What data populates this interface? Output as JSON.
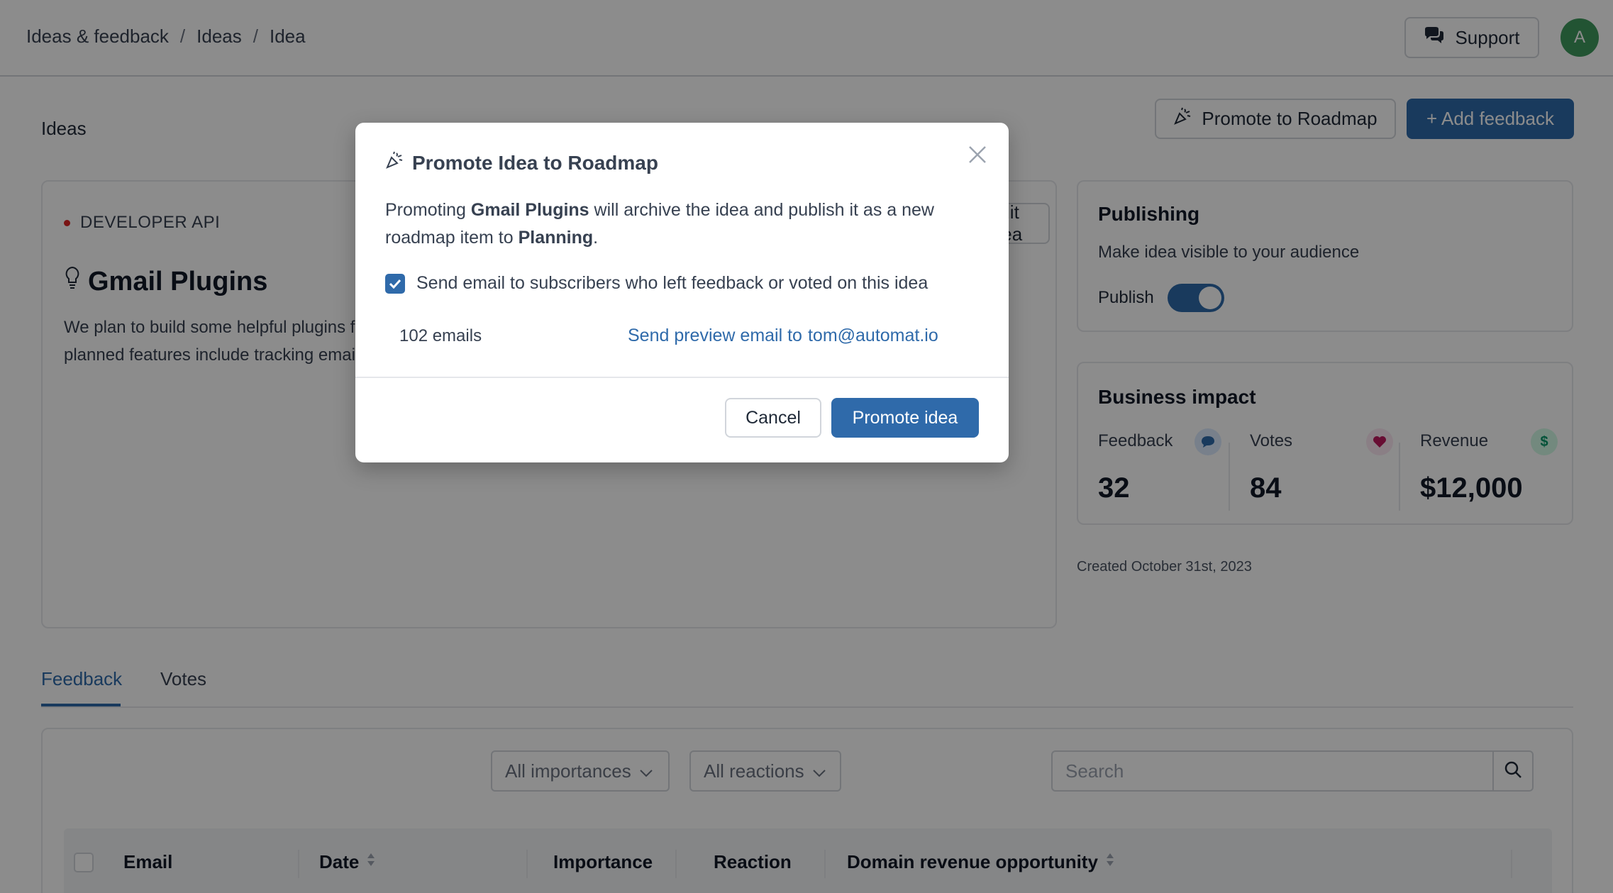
{
  "breadcrumb": {
    "items": [
      "Ideas & feedback",
      "Ideas",
      "Idea"
    ],
    "sep": "/"
  },
  "topbar": {
    "support_label": "Support",
    "avatar_initial": "A"
  },
  "header": {
    "section_title": "Ideas",
    "promote_label": "Promote to Roadmap",
    "add_feedback_label": "+ Add feedback"
  },
  "idea": {
    "category": "DEVELOPER API",
    "title": "Gmail Plugins",
    "description": "We plan to build some helpful plugins for Gmail to make it easier for you to make better use of Acme features. Some of the planned features include tracking email open and click through rate, and auto-organizing your inbox.",
    "edit_label": "Edit idea"
  },
  "publishing": {
    "title": "Publishing",
    "subtitle": "Make idea visible to your audience",
    "publish_label": "Publish",
    "published": true
  },
  "impact": {
    "title": "Business impact",
    "metrics": [
      {
        "label": "Feedback",
        "value": "32"
      },
      {
        "label": "Votes",
        "value": "84"
      },
      {
        "label": "Revenue",
        "value": "$12,000"
      }
    ]
  },
  "created": "Created October 31st, 2023",
  "tabs": [
    {
      "label": "Feedback",
      "active": true
    },
    {
      "label": "Votes",
      "active": false
    }
  ],
  "filters": {
    "importance": "All importances",
    "reactions": "All reactions",
    "search_placeholder": "Search"
  },
  "table": {
    "columns": [
      "Email",
      "Date",
      "Importance",
      "Reaction",
      "Domain revenue opportunity"
    ]
  },
  "modal": {
    "title": "Promote Idea to Roadmap",
    "text_prefix": "Promoting ",
    "idea_name": "Gmail Plugins",
    "text_middle": " will archive the idea and publish it as a new roadmap item to ",
    "target": "Planning",
    "text_suffix": ".",
    "checkbox_label": "Send email to subscribers who left feedback or voted on this idea",
    "checkbox_checked": true,
    "email_count": "102 emails",
    "preview_label": "Send preview email to",
    "preview_email": "tom@automat.io",
    "cancel_label": "Cancel",
    "promote_label": "Promote idea"
  },
  "colors": {
    "accent": "#2f6aaa",
    "avatar": "#3f9a5e",
    "feedback_badge": "#dbeafe",
    "votes_badge": "#fce7f3",
    "revenue_badge": "#d1fae5"
  }
}
